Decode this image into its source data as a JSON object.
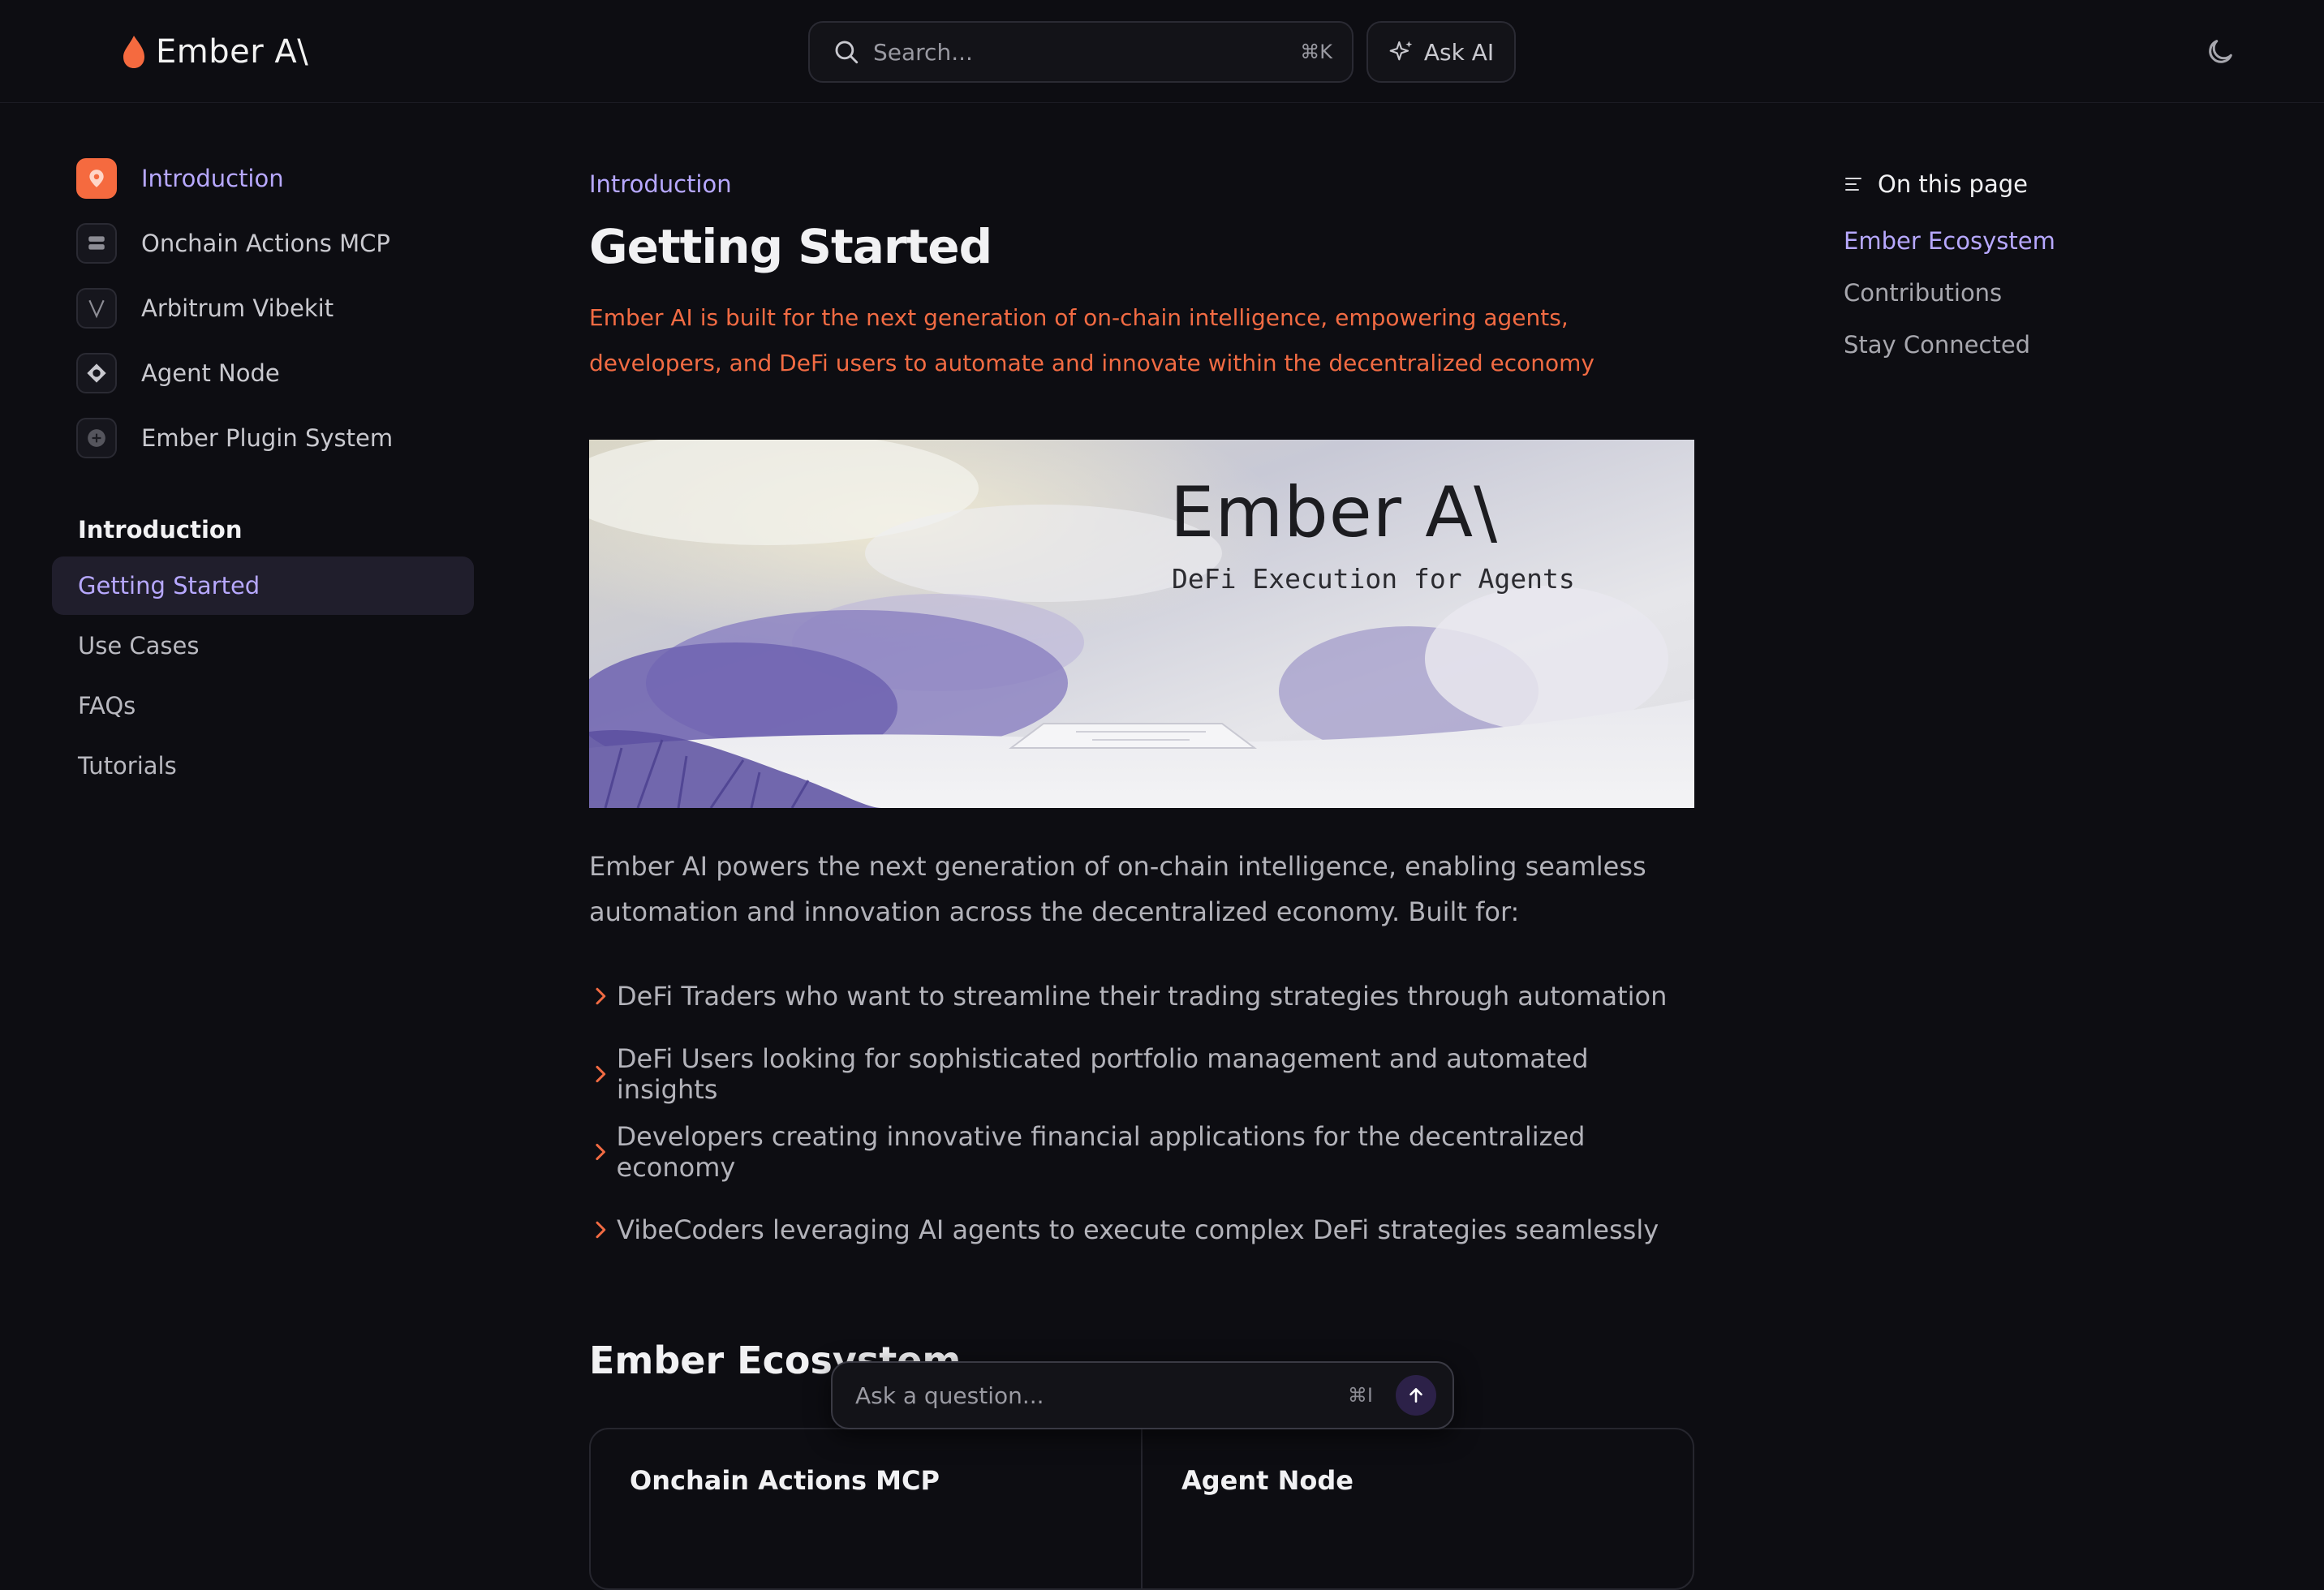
{
  "brand": {
    "name": "Ember A\\",
    "accent": "#f56a3f",
    "link_color": "#b7a8ff"
  },
  "header": {
    "search_placeholder": "Search...",
    "search_shortcut": "⌘K",
    "ask_ai_label": "Ask AI",
    "theme_icon": "moon-icon"
  },
  "sidebar": {
    "sections": [
      {
        "label": "Introduction",
        "icon": "map-pin-icon",
        "active": true
      },
      {
        "label": "Onchain Actions MCP",
        "icon": "server-icon",
        "active": false
      },
      {
        "label": "Arbitrum Vibekit",
        "icon": "v-logo-icon",
        "active": false
      },
      {
        "label": "Agent Node",
        "icon": "node-icon",
        "active": false
      },
      {
        "label": "Ember Plugin System",
        "icon": "plus-circle-icon",
        "active": false
      }
    ],
    "group_title": "Introduction",
    "items": [
      {
        "label": "Getting Started",
        "active": true
      },
      {
        "label": "Use Cases",
        "active": false
      },
      {
        "label": "FAQs",
        "active": false
      },
      {
        "label": "Tutorials",
        "active": false
      }
    ]
  },
  "main": {
    "eyebrow": "Introduction",
    "title": "Getting Started",
    "lead": "Ember AI is built for the next generation of on-chain intelligence, empowering agents, developers, and DeFi users to automate and innovate within the decentralized economy",
    "hero": {
      "title": "Ember A\\",
      "subtitle": "DeFi Execution for Agents"
    },
    "intro": "Ember AI powers the next generation of on-chain intelligence, enabling seamless automation and innovation across the decentralized economy. Built for:",
    "bullets": [
      "DeFi Traders who want to streamline their trading strategies through automation",
      "DeFi Users looking for sophisticated portfolio management and automated insights",
      "Developers creating innovative financial applications for the decentralized economy",
      "VibeCoders leveraging AI agents to execute complex DeFi strategies seamlessly"
    ],
    "ecosystem_heading": "Ember Ecosystem",
    "cards": [
      {
        "title": "Onchain Actions MCP"
      },
      {
        "title": "Agent Node"
      }
    ]
  },
  "toc": {
    "heading": "On this page",
    "links": [
      {
        "label": "Ember Ecosystem",
        "active": true
      },
      {
        "label": "Contributions",
        "active": false
      },
      {
        "label": "Stay Connected",
        "active": false
      }
    ]
  },
  "ask_bar": {
    "placeholder": "Ask a question...",
    "shortcut": "⌘I"
  }
}
